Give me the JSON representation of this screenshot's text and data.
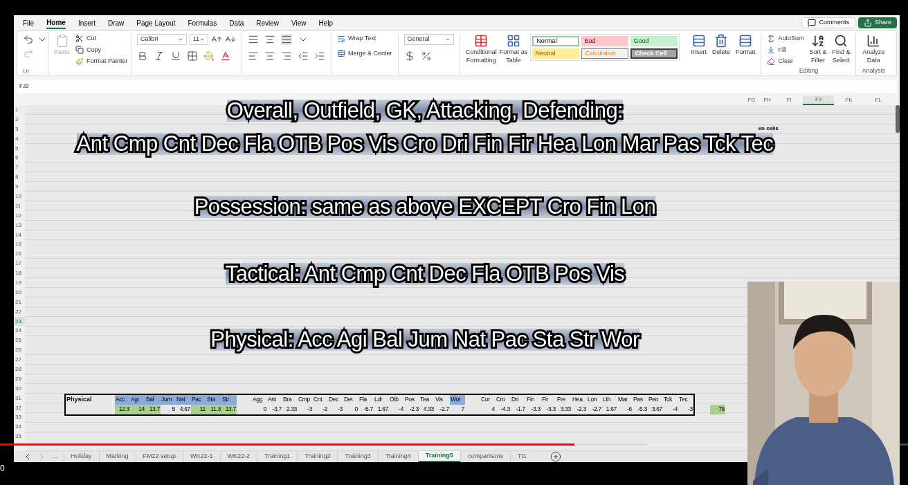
{
  "menu": [
    {
      "label": "File",
      "selected": false
    },
    {
      "label": "Home",
      "selected": true
    },
    {
      "label": "Insert",
      "selected": false
    },
    {
      "label": "Draw",
      "selected": false
    },
    {
      "label": "Page Layout",
      "selected": false
    },
    {
      "label": "Formulas",
      "selected": false
    },
    {
      "label": "Data",
      "selected": false
    },
    {
      "label": "Review",
      "selected": false
    },
    {
      "label": "View",
      "selected": false
    },
    {
      "label": "Help",
      "selected": false
    }
  ],
  "top_buttons": {
    "comments": "Comments",
    "share": "Share"
  },
  "ribbon": {
    "undo_group_label": "Ur",
    "paste": "Paste",
    "cut": "Cut",
    "copy": "Copy",
    "format_painter": "Format Painter",
    "font_name": "Calibri",
    "font_size": "11",
    "wrap_text": "Wrap Text",
    "merge_center": "Merge & Center",
    "number_format": "General",
    "conditional_formatting": [
      "Conditional",
      "Formatting"
    ],
    "format_as_table": [
      "Format as",
      "Table"
    ],
    "cell_styles": [
      {
        "label": "Normal",
        "kind": "normal"
      },
      {
        "label": "Bad",
        "kind": "bad"
      },
      {
        "label": "Good",
        "kind": "good"
      },
      {
        "label": "Neutral",
        "kind": "neutral"
      },
      {
        "label": "Calculation",
        "kind": "calculation"
      },
      {
        "label": "Check Cell",
        "kind": "check"
      }
    ],
    "cells": [
      "Insert",
      "Delete",
      "Format"
    ],
    "autosum": "AutoSum",
    "fill": "Fill",
    "clear": "Clear",
    "sort_filter": [
      "Sort &",
      "Filter"
    ],
    "find_select": [
      "Find &",
      "Select"
    ],
    "editing_label": "Editing",
    "analyze_data": [
      "Analyze",
      "Data"
    ],
    "analysis_label": "Analysis"
  },
  "name_box": "FJ2",
  "column_headers": [
    {
      "label": "FG",
      "selected": false
    },
    {
      "label": "FH",
      "selected": false
    },
    {
      "label": "FI",
      "selected": false
    },
    {
      "label": "FJ",
      "selected": true
    },
    {
      "label": "FK",
      "selected": false
    },
    {
      "label": "FL",
      "selected": false
    }
  ],
  "rows": [
    {
      "number": "1",
      "selected": false
    },
    {
      "number": "2",
      "selected": false
    },
    {
      "number": "3",
      "selected": false
    },
    {
      "number": "4",
      "selected": false
    },
    {
      "number": "5",
      "selected": false
    },
    {
      "number": "6",
      "selected": false
    },
    {
      "number": "7",
      "selected": false
    },
    {
      "number": "8",
      "selected": false
    },
    {
      "number": "9",
      "selected": false
    },
    {
      "number": "10",
      "selected": false
    },
    {
      "number": "11",
      "selected": false
    },
    {
      "number": "12",
      "selected": false
    },
    {
      "number": "13",
      "selected": false
    },
    {
      "number": "14",
      "selected": false
    },
    {
      "number": "15",
      "selected": false
    },
    {
      "number": "16",
      "selected": false
    },
    {
      "number": "17",
      "selected": false
    },
    {
      "number": "18",
      "selected": false
    },
    {
      "number": "19",
      "selected": false
    },
    {
      "number": "20",
      "selected": false
    },
    {
      "number": "21",
      "selected": false
    },
    {
      "number": "22",
      "selected": false
    },
    {
      "number": "23",
      "selected": true
    },
    {
      "number": "24",
      "selected": false
    },
    {
      "number": "25",
      "selected": false
    },
    {
      "number": "26",
      "selected": false
    },
    {
      "number": "27",
      "selected": false
    },
    {
      "number": "28",
      "selected": false
    },
    {
      "number": "29",
      "selected": false
    },
    {
      "number": "30",
      "selected": false
    },
    {
      "number": "31",
      "selected": false
    },
    {
      "number": "32",
      "selected": false
    },
    {
      "number": "33",
      "selected": false
    },
    {
      "number": "34",
      "selected": false
    },
    {
      "number": "35",
      "selected": false
    }
  ],
  "cell_note": "en cells",
  "captions": [
    "Overall, Outfield, GK, Attacking, Defending:",
    "Ant Cmp Cnt Dec Fla OTB Pos Vis Cro Dri Fin Fir Hea Lon Mar Pas Tck Tec",
    "Possession: same as above EXCEPT Cro Fin Lon",
    "Tactical: Ant Cmp Cnt Dec Fla OTB Pos Vis",
    "Physical: Acc Agi Bal Jum Nat Pac Sta Str Wor"
  ],
  "stat_table": {
    "label": "Physical",
    "groups": [
      {
        "columns": [
          {
            "header": "Acc",
            "value": "12.3",
            "header_highlight": true,
            "value_highlight": true
          },
          {
            "header": "Agi",
            "value": "14",
            "header_highlight": true,
            "value_highlight": true
          },
          {
            "header": "Bal",
            "value": "13.7",
            "header_highlight": true,
            "value_highlight": true
          },
          {
            "header": "Jum",
            "value": "5",
            "header_highlight": true,
            "value_highlight": false
          },
          {
            "header": "Nat",
            "value": "4.67",
            "header_highlight": true,
            "value_highlight": false
          },
          {
            "header": "Pac",
            "value": "11",
            "header_highlight": true,
            "value_highlight": true
          },
          {
            "header": "Sta",
            "value": "11.3",
            "header_highlight": true,
            "value_highlight": true
          },
          {
            "header": "Str",
            "value": "13.7",
            "header_highlight": true,
            "value_highlight": true
          }
        ]
      },
      {
        "columns": [
          {
            "header": "Agg",
            "value": "0",
            "header_highlight": false,
            "value_highlight": false
          },
          {
            "header": "Ant",
            "value": "-3.7",
            "header_highlight": false,
            "value_highlight": false
          },
          {
            "header": "Bra",
            "value": "2.33",
            "header_highlight": false,
            "value_highlight": false
          },
          {
            "header": "Cmp",
            "value": "-3",
            "header_highlight": false,
            "value_highlight": false
          },
          {
            "header": "Cnt",
            "value": "-2",
            "header_highlight": false,
            "value_highlight": false
          },
          {
            "header": "Dec",
            "value": "-3",
            "header_highlight": false,
            "value_highlight": false
          },
          {
            "header": "Det",
            "value": "0",
            "header_highlight": false,
            "value_highlight": false
          },
          {
            "header": "Fla",
            "value": "-5.7",
            "header_highlight": false,
            "value_highlight": false
          },
          {
            "header": "Ldr",
            "value": "1.67",
            "header_highlight": false,
            "value_highlight": false
          },
          {
            "header": "Otb",
            "value": "-4",
            "header_highlight": false,
            "value_highlight": false
          },
          {
            "header": "Pos",
            "value": "-2.3",
            "header_highlight": false,
            "value_highlight": false
          },
          {
            "header": "Tea",
            "value": "4.33",
            "header_highlight": false,
            "value_highlight": false
          },
          {
            "header": "Vis",
            "value": "-2.7",
            "header_highlight": false,
            "value_highlight": false
          },
          {
            "header": "Wor",
            "value": "7",
            "header_highlight": true,
            "value_highlight": false
          }
        ]
      },
      {
        "columns": [
          {
            "header": "Cor",
            "value": "4",
            "header_highlight": false,
            "value_highlight": false
          },
          {
            "header": "Cro",
            "value": "-4.3",
            "header_highlight": false,
            "value_highlight": false
          },
          {
            "header": "Dri",
            "value": "-1.7",
            "header_highlight": false,
            "value_highlight": false
          },
          {
            "header": "Fin",
            "value": "-3.3",
            "header_highlight": false,
            "value_highlight": false
          },
          {
            "header": "Fir",
            "value": "-3.3",
            "header_highlight": false,
            "value_highlight": false
          },
          {
            "header": "Fre",
            "value": "3.33",
            "header_highlight": false,
            "value_highlight": false
          },
          {
            "header": "Hea",
            "value": "-2.3",
            "header_highlight": false,
            "value_highlight": false
          },
          {
            "header": "Lon",
            "value": "-2.7",
            "header_highlight": false,
            "value_highlight": false
          },
          {
            "header": "Lth",
            "value": "1.67",
            "header_highlight": false,
            "value_highlight": false
          },
          {
            "header": "Mar",
            "value": "-6",
            "header_highlight": false,
            "value_highlight": false
          },
          {
            "header": "Pas",
            "value": "-5.3",
            "header_highlight": false,
            "value_highlight": false
          },
          {
            "header": "Pen",
            "value": "3.67",
            "header_highlight": false,
            "value_highlight": false
          },
          {
            "header": "Tck",
            "value": "-4",
            "header_highlight": false,
            "value_highlight": false
          },
          {
            "header": "Tec",
            "value": "-3",
            "header_highlight": false,
            "value_highlight": false
          }
        ]
      }
    ]
  },
  "extra_cell": {
    "value": "76",
    "highlight": true
  },
  "sheet_more": "...",
  "sheets": [
    {
      "label": "Holiday",
      "selected": false
    },
    {
      "label": "Marking",
      "selected": false
    },
    {
      "label": "FM22 setup",
      "selected": false
    },
    {
      "label": "WK22-1",
      "selected": false
    },
    {
      "label": "WK22-2",
      "selected": false
    },
    {
      "label": "Training1",
      "selected": false
    },
    {
      "label": "Training2",
      "selected": false
    },
    {
      "label": "Training3",
      "selected": false
    },
    {
      "label": "Training4",
      "selected": false
    },
    {
      "label": "Training5",
      "selected": true
    },
    {
      "label": "comparisons",
      "selected": false
    },
    {
      "label": "TI1",
      "selected": false
    }
  ],
  "video": {
    "progress": {
      "level": 0.633
    },
    "buffer": {
      "level": 0.713
    },
    "time": "0"
  }
}
